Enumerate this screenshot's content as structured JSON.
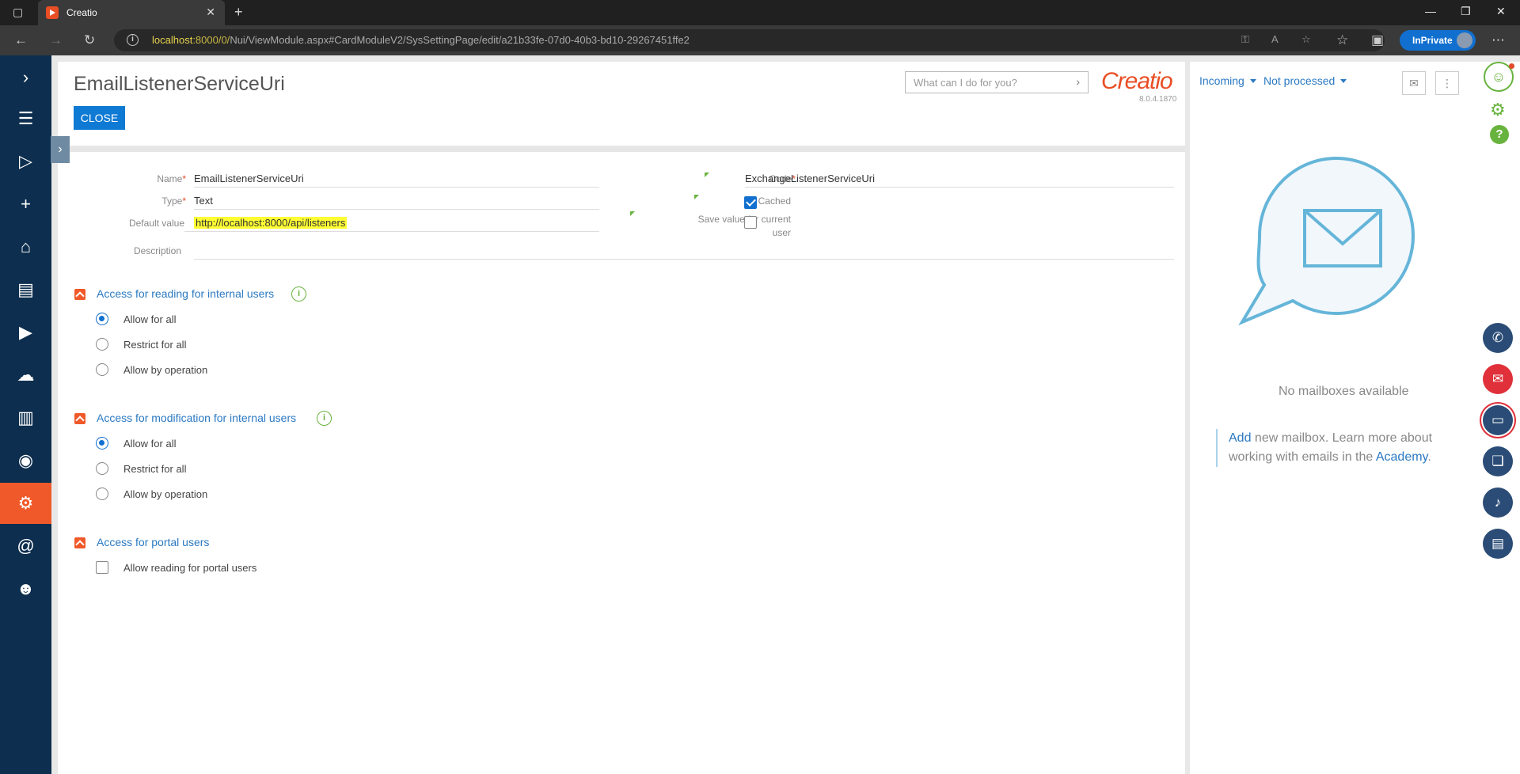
{
  "browser": {
    "tab_title": "Creatio",
    "url_host": "localhost",
    "url_port_path": ":8000/0/",
    "url_rest": "Nui/ViewModule.aspx#CardModuleV2/SysSettingPage/edit/a21b33fe-07d0-40b3-bd10-29267451ffe2",
    "inprivate_label": "InPrivate"
  },
  "card": {
    "title": "EmailListenerServiceUri",
    "close_label": "CLOSE",
    "search_placeholder": "What can I do for you?",
    "logo_text": "Creatio",
    "version": "8.0.4.1870",
    "fields": {
      "name_label": "Name",
      "name_value": "EmailListenerServiceUri",
      "type_label": "Type",
      "type_value": "Text",
      "default_label": "Default value",
      "default_value": "http://localhost:8000/api/listeners",
      "description_label": "Description",
      "code_label": "Code",
      "code_value": "ExchangeListenerServiceUri",
      "cached_label": "Cached",
      "cached_checked": true,
      "save_current_label_1": "Save value for current",
      "save_current_label_2": "user",
      "save_current_checked": false
    },
    "sections": [
      {
        "title": "Access for reading for internal users",
        "options": [
          "Allow for all",
          "Restrict for all",
          "Allow by operation"
        ],
        "selected": 0
      },
      {
        "title": "Access for modification for internal users",
        "options": [
          "Allow for all",
          "Restrict for all",
          "Allow by operation"
        ],
        "selected": 0
      },
      {
        "title": "Access for portal users",
        "checkbox_label": "Allow reading for portal users",
        "checkbox_checked": false
      }
    ]
  },
  "right_panel": {
    "filter_direction": "Incoming",
    "filter_status": "Not processed",
    "no_mailboxes": "No mailboxes available",
    "add_link": "Add",
    "add_text_1": " new mailbox. Learn more about working with emails in the ",
    "academy_link": "Academy",
    "add_text_end": "."
  },
  "colors": {
    "brand": "#e94e24",
    "nav_bg": "#0d2e4e",
    "active_nav": "#f0592a",
    "accent_blue": "#0e7ad4",
    "link": "#2b79c2",
    "highlight": "#ffff33"
  }
}
